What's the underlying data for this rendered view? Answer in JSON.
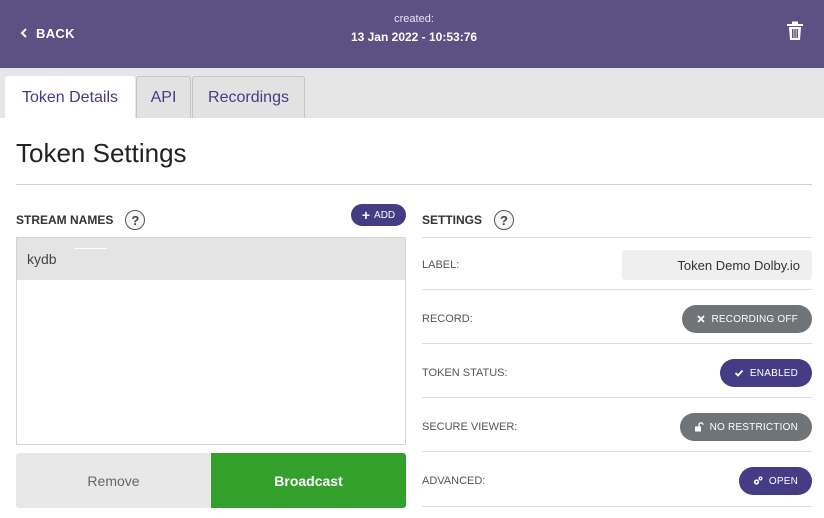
{
  "header": {
    "back_label": "BACK",
    "created_label": "created:",
    "created_value": "13 Jan 2022 - 10:53:76"
  },
  "tabs": [
    {
      "label": "Token Details",
      "active": true
    },
    {
      "label": "API",
      "active": false
    },
    {
      "label": "Recordings",
      "active": false
    }
  ],
  "page_title": "Token Settings",
  "stream_names": {
    "heading": "STREAM NAMES",
    "help": "?",
    "add_label": "ADD",
    "items": [
      "kydb"
    ],
    "remove_label": "Remove",
    "broadcast_label": "Broadcast"
  },
  "settings": {
    "heading": "SETTINGS",
    "help": "?",
    "label_label": "LABEL:",
    "label_value": "Token Demo Dolby.io",
    "record_label": "RECORD:",
    "record_button": "RECORDING OFF",
    "token_status_label": "TOKEN STATUS:",
    "token_status_button": "ENABLED",
    "secure_viewer_label": "SECURE VIEWER:",
    "secure_viewer_button": "NO RESTRICTION",
    "advanced_label": "ADVANCED:",
    "advanced_button": "OPEN"
  },
  "colors": {
    "header_bg": "#5c5183",
    "accent": "#463b85",
    "broadcast": "#33a02c",
    "pill_grey": "#6e7478"
  }
}
